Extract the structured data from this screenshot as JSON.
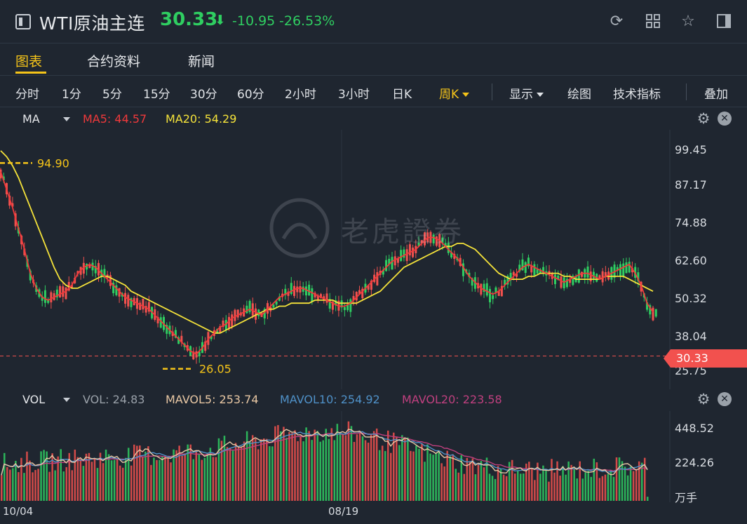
{
  "header": {
    "title": "WTI原油主连",
    "price": "30.33",
    "price_arrow": "⬇",
    "change": "-10.95",
    "change_pct": "-26.53%"
  },
  "tabs": [
    {
      "label": "图表",
      "active": true
    },
    {
      "label": "合约资料",
      "active": false
    },
    {
      "label": "新闻",
      "active": false
    }
  ],
  "toolbar": {
    "periods": [
      "分时",
      "1分",
      "5分",
      "15分",
      "30分",
      "60分",
      "2小时",
      "3小时",
      "日K",
      "周K"
    ],
    "active_period": "周K",
    "display_label": "显示",
    "draw_label": "绘图",
    "indicators_label": "技术指标",
    "overlay_label": "叠加"
  },
  "ma_bar": {
    "name": "MA",
    "ma5": "MA5: 44.57",
    "ma20": "MA20: 54.29"
  },
  "vol_bar": {
    "name": "VOL",
    "vol": "VOL: 24.83",
    "mavol5": "MAVOL5: 253.74",
    "mavol10": "MAVOL10: 254.92",
    "mavol20": "MAVOL20: 223.58"
  },
  "price_axis": [
    "99.45",
    "87.17",
    "74.88",
    "62.60",
    "50.32",
    "38.04",
    "25.75"
  ],
  "vol_axis": [
    "448.52",
    "224.26"
  ],
  "vol_unit": "万手",
  "current_price_tag": "30.33",
  "high_marker": "94.90",
  "low_marker": "26.05",
  "x_axis_labels": [
    "10/04",
    "08/19"
  ],
  "watermark": "老虎證券",
  "colors": {
    "up": "#2fce61",
    "down": "#f2514e",
    "ma5": "#f0393b",
    "ma20": "#f5e33a",
    "accent": "#f5c419",
    "mavol5": "#e9c8a4",
    "mavol10": "#4f91c8",
    "mavol20": "#c0407f"
  },
  "chart_data": {
    "type": "candlestick",
    "period": "weekly",
    "ylim": [
      25.75,
      99.45
    ],
    "ma5_path": [
      92,
      86,
      80,
      73,
      66,
      58,
      53,
      50,
      49,
      50,
      51,
      52,
      54,
      58,
      60,
      61,
      60,
      58,
      56,
      54,
      52,
      50,
      49,
      48,
      47,
      46,
      44,
      42,
      40,
      38,
      36,
      34,
      32,
      31,
      33,
      36,
      38,
      40,
      41,
      43,
      44,
      45,
      46,
      45,
      44,
      46,
      48,
      50,
      51,
      52,
      53,
      53,
      52,
      51,
      50,
      49,
      48,
      47,
      47,
      48,
      50,
      52,
      54,
      56,
      58,
      60,
      62,
      63,
      64,
      65,
      66,
      68,
      70,
      70,
      69,
      67,
      65,
      63,
      60,
      57,
      55,
      53,
      52,
      51,
      52,
      54,
      56,
      58,
      60,
      61,
      60,
      59,
      58,
      57,
      56,
      55,
      56,
      57,
      58,
      58,
      57,
      56,
      57,
      58,
      59,
      60,
      61,
      58,
      54,
      48,
      45
    ],
    "ma20_path": [
      99,
      97,
      94,
      90,
      85,
      80,
      75,
      70,
      65,
      60,
      56,
      54,
      53,
      53,
      54,
      55,
      56,
      57,
      57,
      56,
      55,
      54,
      52,
      51,
      50,
      49,
      48,
      47,
      46,
      45,
      44,
      43,
      42,
      41,
      40,
      39,
      38,
      38,
      39,
      40,
      41,
      42,
      43,
      44,
      45,
      46,
      46,
      47,
      47,
      48,
      48,
      48,
      48,
      49,
      49,
      49,
      49,
      48,
      48,
      48,
      48,
      49,
      50,
      51,
      52,
      54,
      56,
      58,
      60,
      61,
      62,
      63,
      64,
      65,
      66,
      67,
      67,
      68,
      68,
      67,
      66,
      64,
      62,
      60,
      58,
      57,
      56,
      56,
      56,
      57,
      57,
      58,
      58,
      58,
      58,
      57,
      57,
      56,
      56,
      56,
      56,
      56,
      57,
      57,
      57,
      57,
      56,
      55,
      54,
      53,
      52
    ],
    "volume": {
      "latest": 24.83,
      "mavol5": 253.74,
      "mavol10": 254.92,
      "mavol20": 223.58,
      "ylim": [
        0,
        448.52
      ]
    }
  }
}
